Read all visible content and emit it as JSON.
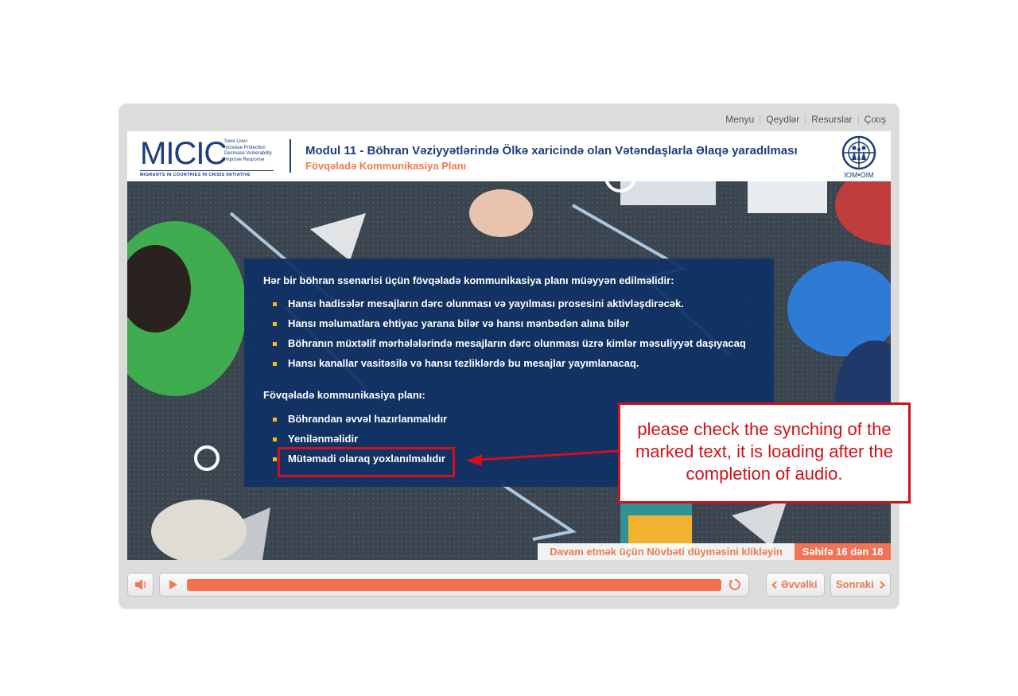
{
  "topmenu": {
    "items": [
      "Menyu",
      "Qeydlər",
      "Resurslar",
      "Çıxış"
    ]
  },
  "header": {
    "logo": {
      "word": "MICIC",
      "tagline": [
        "Save Lives",
        "Increase Protection",
        "Decrease Vulnerability",
        "Improve Response"
      ],
      "subtitle": "MIGRANTS IN COUNTRIES IN CRISIS INITIATIVE"
    },
    "module_title": "Modul 11 - Böhran Vəziyyətlərində Ölkə xaricində olan Vətəndaşlarla Əlaqə yaradılması",
    "page_subtitle": "Fövqəladə Kommunikasiya Planı",
    "org_logo_text": "IOM•OIM"
  },
  "content": {
    "heading1": "Hər bir böhran ssenarisi üçün fövqəladə kommunikasiya planı müəyyən edilməlidir:",
    "list1": [
      "Hansı hadisələr mesajların dərc olunması və yayılması prosesini aktivləşdirəcək.",
      "Hansı məlumatlara ehtiyac yarana bilər və hansı mənbədən alına bilər",
      "Böhranın müxtəlif mərhələlərində mesajların dərc olunması üzrə kimlər məsuliyyət daşıyacaq",
      "Hansı kanallar vasitəsilə və hansı tezliklərdə bu mesajlar yayımlanacaq."
    ],
    "heading2": "Fövqəladə kommunikasiya planı:",
    "list2": [
      "Böhrandan əvvəl hazırlanmalıdır",
      "Yenilənməlidir",
      "Mütəmadi olaraq yoxlanılmalıdır"
    ]
  },
  "status": {
    "hint": "Davam etmək üçün Növbəti düyməsini klikləyin",
    "page_count": "Səhifə 16 dən 18"
  },
  "controls": {
    "audio_icon": "speaker-icon",
    "play_icon": "play-icon",
    "replay_icon": "replay-icon",
    "prev_label": "Əvvəlki",
    "next_label": "Sonraki",
    "progress": 1.0
  },
  "annotation": {
    "text": "please check the synching of the marked text, it is loading after the completion of audio."
  },
  "colors": {
    "brand_blue": "#1e3d7a",
    "accent_orange": "#f07a50",
    "panel_blue": "#0e3064",
    "bullet_yellow": "#f5b820",
    "annotation_red": "#d0111b"
  }
}
